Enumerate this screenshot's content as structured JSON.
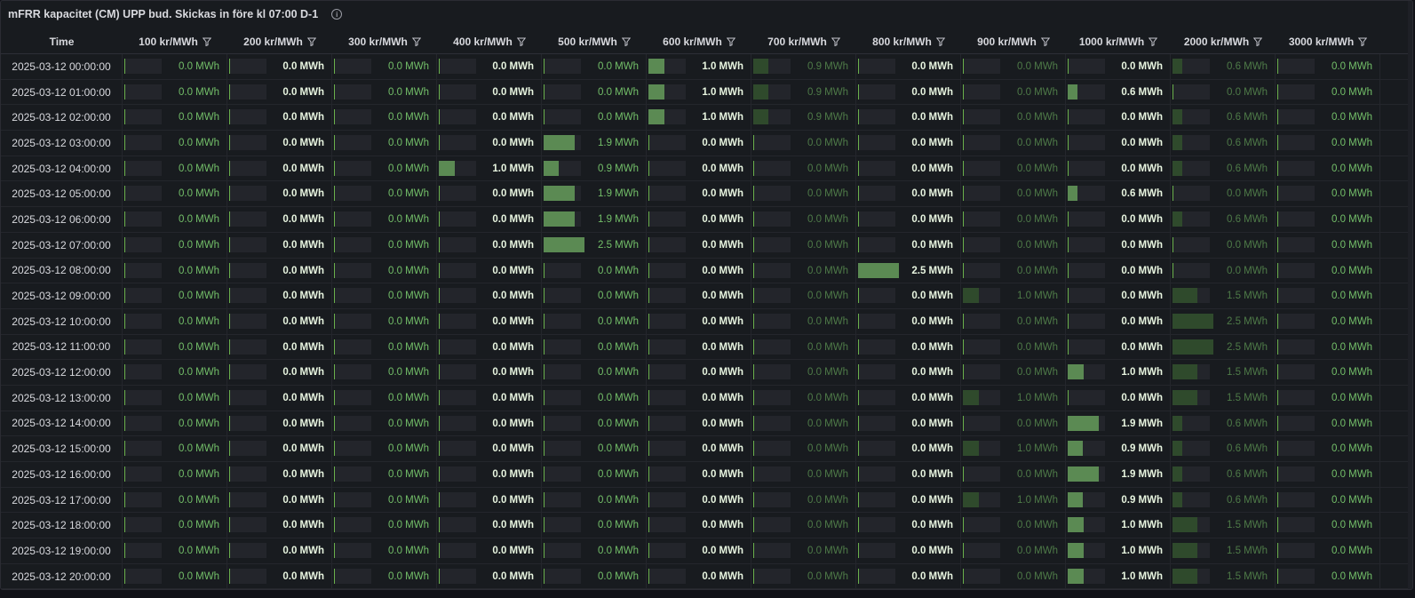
{
  "panel": {
    "title": "mFRR kapacitet (CM) UPP bud. Skickas in före kl 07:00 D-1",
    "info_icon": "info-icon"
  },
  "table": {
    "columns": [
      "Time",
      "100 kr/MWh",
      "200 kr/MWh",
      "300 kr/MWh",
      "400 kr/MWh",
      "500 kr/MWh",
      "600 kr/MWh",
      "700 kr/MWh",
      "800 kr/MWh",
      "900 kr/MWh",
      "1000 kr/MWh",
      "2000 kr/MWh",
      "3000 kr/MWh"
    ],
    "unit": "MWh",
    "column_styles": [
      "green",
      "bold",
      "green",
      "bold",
      "green",
      "bold",
      "dim",
      "bold",
      "dim",
      "bold",
      "dim",
      "green"
    ],
    "rows": [
      {
        "time": "2025-03-12 00:00:00",
        "values": [
          "0.0",
          "0.0",
          "0.0",
          "0.0",
          "0.0",
          "1.0",
          "0.9",
          "0.0",
          "0.0",
          "0.0",
          "0.6",
          "0.0"
        ]
      },
      {
        "time": "2025-03-12 01:00:00",
        "values": [
          "0.0",
          "0.0",
          "0.0",
          "0.0",
          "0.0",
          "1.0",
          "0.9",
          "0.0",
          "0.0",
          "0.6",
          "0.0",
          "0.0"
        ]
      },
      {
        "time": "2025-03-12 02:00:00",
        "values": [
          "0.0",
          "0.0",
          "0.0",
          "0.0",
          "0.0",
          "1.0",
          "0.9",
          "0.0",
          "0.0",
          "0.0",
          "0.6",
          "0.0"
        ]
      },
      {
        "time": "2025-03-12 03:00:00",
        "values": [
          "0.0",
          "0.0",
          "0.0",
          "0.0",
          "1.9",
          "0.0",
          "0.0",
          "0.0",
          "0.0",
          "0.0",
          "0.6",
          "0.0"
        ]
      },
      {
        "time": "2025-03-12 04:00:00",
        "values": [
          "0.0",
          "0.0",
          "0.0",
          "1.0",
          "0.9",
          "0.0",
          "0.0",
          "0.0",
          "0.0",
          "0.0",
          "0.6",
          "0.0"
        ]
      },
      {
        "time": "2025-03-12 05:00:00",
        "values": [
          "0.0",
          "0.0",
          "0.0",
          "0.0",
          "1.9",
          "0.0",
          "0.0",
          "0.0",
          "0.0",
          "0.6",
          "0.0",
          "0.0"
        ]
      },
      {
        "time": "2025-03-12 06:00:00",
        "values": [
          "0.0",
          "0.0",
          "0.0",
          "0.0",
          "1.9",
          "0.0",
          "0.0",
          "0.0",
          "0.0",
          "0.0",
          "0.6",
          "0.0"
        ]
      },
      {
        "time": "2025-03-12 07:00:00",
        "values": [
          "0.0",
          "0.0",
          "0.0",
          "0.0",
          "2.5",
          "0.0",
          "0.0",
          "0.0",
          "0.0",
          "0.0",
          "0.0",
          "0.0"
        ]
      },
      {
        "time": "2025-03-12 08:00:00",
        "values": [
          "0.0",
          "0.0",
          "0.0",
          "0.0",
          "0.0",
          "0.0",
          "0.0",
          "2.5",
          "0.0",
          "0.0",
          "0.0",
          "0.0"
        ]
      },
      {
        "time": "2025-03-12 09:00:00",
        "values": [
          "0.0",
          "0.0",
          "0.0",
          "0.0",
          "0.0",
          "0.0",
          "0.0",
          "0.0",
          "1.0",
          "0.0",
          "1.5",
          "0.0"
        ]
      },
      {
        "time": "2025-03-12 10:00:00",
        "values": [
          "0.0",
          "0.0",
          "0.0",
          "0.0",
          "0.0",
          "0.0",
          "0.0",
          "0.0",
          "0.0",
          "0.0",
          "2.5",
          "0.0"
        ]
      },
      {
        "time": "2025-03-12 11:00:00",
        "values": [
          "0.0",
          "0.0",
          "0.0",
          "0.0",
          "0.0",
          "0.0",
          "0.0",
          "0.0",
          "0.0",
          "0.0",
          "2.5",
          "0.0"
        ]
      },
      {
        "time": "2025-03-12 12:00:00",
        "values": [
          "0.0",
          "0.0",
          "0.0",
          "0.0",
          "0.0",
          "0.0",
          "0.0",
          "0.0",
          "0.0",
          "1.0",
          "1.5",
          "0.0"
        ]
      },
      {
        "time": "2025-03-12 13:00:00",
        "values": [
          "0.0",
          "0.0",
          "0.0",
          "0.0",
          "0.0",
          "0.0",
          "0.0",
          "0.0",
          "1.0",
          "0.0",
          "1.5",
          "0.0"
        ]
      },
      {
        "time": "2025-03-12 14:00:00",
        "values": [
          "0.0",
          "0.0",
          "0.0",
          "0.0",
          "0.0",
          "0.0",
          "0.0",
          "0.0",
          "0.0",
          "1.9",
          "0.6",
          "0.0"
        ]
      },
      {
        "time": "2025-03-12 15:00:00",
        "values": [
          "0.0",
          "0.0",
          "0.0",
          "0.0",
          "0.0",
          "0.0",
          "0.0",
          "0.0",
          "1.0",
          "0.9",
          "0.6",
          "0.0"
        ]
      },
      {
        "time": "2025-03-12 16:00:00",
        "values": [
          "0.0",
          "0.0",
          "0.0",
          "0.0",
          "0.0",
          "0.0",
          "0.0",
          "0.0",
          "0.0",
          "1.9",
          "0.6",
          "0.0"
        ]
      },
      {
        "time": "2025-03-12 17:00:00",
        "values": [
          "0.0",
          "0.0",
          "0.0",
          "0.0",
          "0.0",
          "0.0",
          "0.0",
          "0.0",
          "1.0",
          "0.9",
          "0.6",
          "0.0"
        ]
      },
      {
        "time": "2025-03-12 18:00:00",
        "values": [
          "0.0",
          "0.0",
          "0.0",
          "0.0",
          "0.0",
          "0.0",
          "0.0",
          "0.0",
          "0.0",
          "1.0",
          "1.5",
          "0.0"
        ]
      },
      {
        "time": "2025-03-12 19:00:00",
        "values": [
          "0.0",
          "0.0",
          "0.0",
          "0.0",
          "0.0",
          "0.0",
          "0.0",
          "0.0",
          "0.0",
          "1.0",
          "1.5",
          "0.0"
        ]
      },
      {
        "time": "2025-03-12 20:00:00",
        "values": [
          "0.0",
          "0.0",
          "0.0",
          "0.0",
          "0.0",
          "0.0",
          "0.0",
          "0.0",
          "0.0",
          "1.0",
          "1.5",
          "0.0"
        ]
      }
    ],
    "max_value": 2.5
  },
  "colors": {
    "bar_bright": "#5b8a53",
    "bar_dim": "#2f4a2c",
    "bar_bg": "#23252b"
  }
}
